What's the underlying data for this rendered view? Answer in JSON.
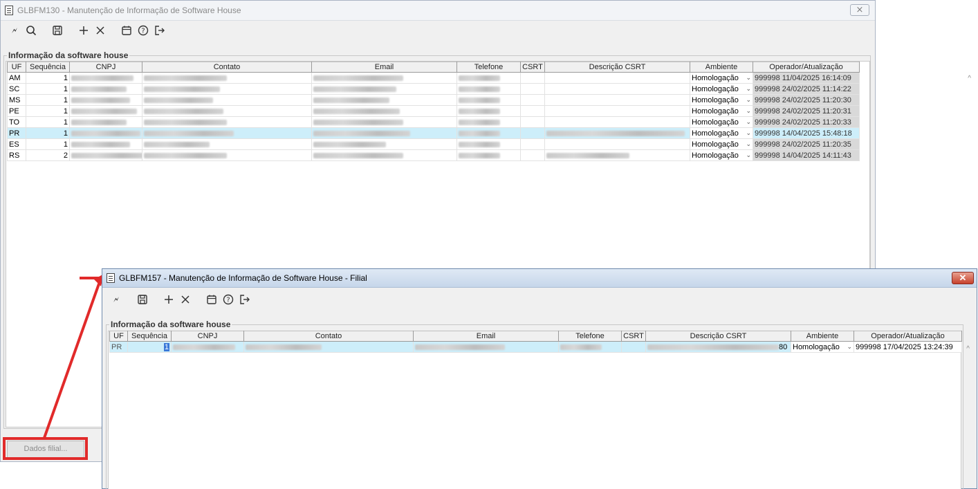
{
  "window_main": {
    "title": "GLBFM130 - Manutenção de Informação de Software House",
    "close_label": "⨯⨯",
    "group_title": "Informação da software house",
    "columns": [
      "UF",
      "Sequência",
      "CNPJ",
      "Contato",
      "Email",
      "Telefone",
      "CSRT",
      "Descrição CSRT",
      "Ambiente",
      "Operador/Atualização"
    ],
    "rows": [
      {
        "uf": "AM",
        "seq": "1",
        "ambiente": "Homologação",
        "operador": "999998",
        "atualizacao": "11/04/2025 16:14:09"
      },
      {
        "uf": "SC",
        "seq": "1",
        "ambiente": "Homologação",
        "operador": "999998",
        "atualizacao": "24/02/2025 11:14:22"
      },
      {
        "uf": "MS",
        "seq": "1",
        "ambiente": "Homologação",
        "operador": "999998",
        "atualizacao": "24/02/2025 11:20:30"
      },
      {
        "uf": "PE",
        "seq": "1",
        "ambiente": "Homologação",
        "operador": "999998",
        "atualizacao": "24/02/2025 11:20:31"
      },
      {
        "uf": "TO",
        "seq": "1",
        "ambiente": "Homologação",
        "operador": "999998",
        "atualizacao": "24/02/2025 11:20:33"
      },
      {
        "uf": "PR",
        "seq": "1",
        "ambiente": "Homologação",
        "operador": "999998",
        "atualizacao": "14/04/2025 15:48:18"
      },
      {
        "uf": "ES",
        "seq": "1",
        "ambiente": "Homologação",
        "operador": "999998",
        "atualizacao": "24/02/2025 11:20:35"
      },
      {
        "uf": "RS",
        "seq": "2",
        "ambiente": "Homologação",
        "operador": "999998",
        "atualizacao": "14/04/2025 14:11:43"
      }
    ],
    "dados_filial_label": "Dados filial..."
  },
  "window_filial": {
    "title": "GLBFM157 - Manutenção de Informação de Software House - Filial",
    "close_label": "✕",
    "group_title": "Informação da software house",
    "columns": [
      "UF",
      "Sequência",
      "CNPJ",
      "Contato",
      "Email",
      "Telefone",
      "CSRT",
      "Descrição CSRT",
      "Ambiente",
      "Operador/Atualização"
    ],
    "row": {
      "uf": "PR",
      "seq": "1",
      "desc_suffix": "80",
      "ambiente": "Homologação",
      "operador": "999998",
      "atualizacao": "17/04/2025 13:24:39"
    }
  },
  "toolbar_icons": [
    "cursor-icon",
    "search-icon",
    "save-icon",
    "add-icon",
    "delete-icon",
    "calendar-icon",
    "help-icon",
    "exit-icon"
  ],
  "colors": {
    "highlight": "#e12a2a",
    "selected_row": "#cdeefa"
  }
}
